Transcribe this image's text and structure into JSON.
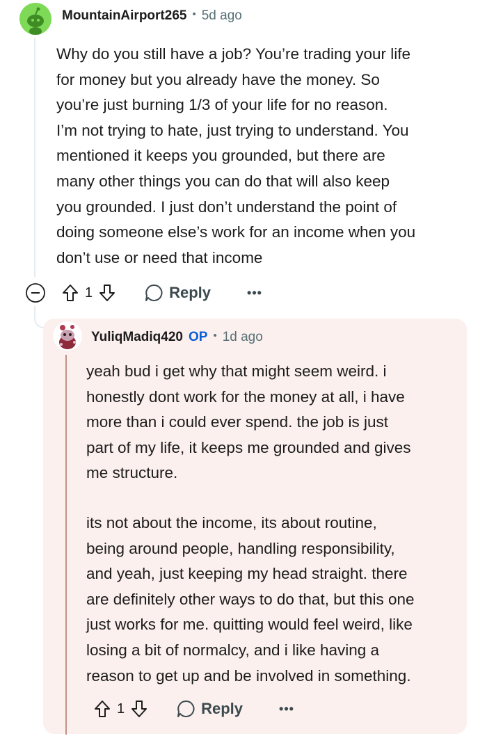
{
  "comment": {
    "username": "MountainAirport265",
    "time": "5d ago",
    "lines": [
      "Why do you still have a job? You’re trading your life",
      "for money but you already have the money. So",
      "you’re just burning 1/3 of your life for no reason.",
      "I’m not trying to hate, just trying to understand. You",
      "mentioned it keeps you grounded, but there are",
      "many other things you can do that will also keep",
      "you grounded. I just don’t understand the point of",
      "doing someone else’s work for an income when you",
      "don’t use or need that income"
    ],
    "score": "1",
    "reply_label": "Reply",
    "more": "•••"
  },
  "reply": {
    "username": "YuliqMadiq420",
    "op_badge": "OP",
    "time": "1d ago",
    "paragraph1": [
      "yeah bud i get why that might seem weird. i",
      "honestly dont work for the money at all, i have",
      "more than i could ever spend. the job is just",
      "part of my life, it keeps me grounded and gives",
      "me structure."
    ],
    "paragraph2": [
      "its not about the income, its about routine,",
      "being around people, handling responsibility,",
      "and yeah, just keeping my head straight. there",
      "are definitely other ways to do that, but this one",
      "just works for me. quitting would feel weird, like",
      "losing a bit of normalcy, and i like having a",
      "reason to get up and be involved in something."
    ],
    "score": "1",
    "reply_label": "Reply",
    "more": "•••"
  },
  "colors": {
    "reply_bg": "#fbf0ee",
    "avatar_green": "#7ed957",
    "op_blue": "#0a5ed7",
    "muted": "#576f76"
  }
}
